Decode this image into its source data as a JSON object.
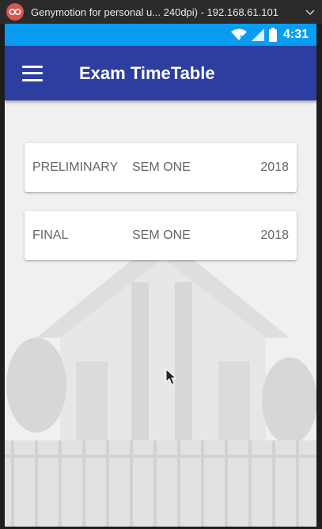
{
  "window": {
    "title": "Genymotion for personal u... 240dpi) - 192.168.61.101"
  },
  "status_bar": {
    "time": "4:31",
    "color": "#0a9cf0"
  },
  "app_bar": {
    "title": "Exam TimeTable",
    "color": "#2d3ea0"
  },
  "exams": [
    {
      "type": "PRELIMINARY",
      "semester": "SEM ONE",
      "year": "2018"
    },
    {
      "type": "FINAL",
      "semester": "SEM ONE",
      "year": "2018"
    }
  ],
  "icons": [
    "genymotion-logo-icon",
    "chevron-down-icon",
    "wifi-icon",
    "signal-icon",
    "battery-icon",
    "menu-icon",
    "mouse-cursor-icon"
  ]
}
